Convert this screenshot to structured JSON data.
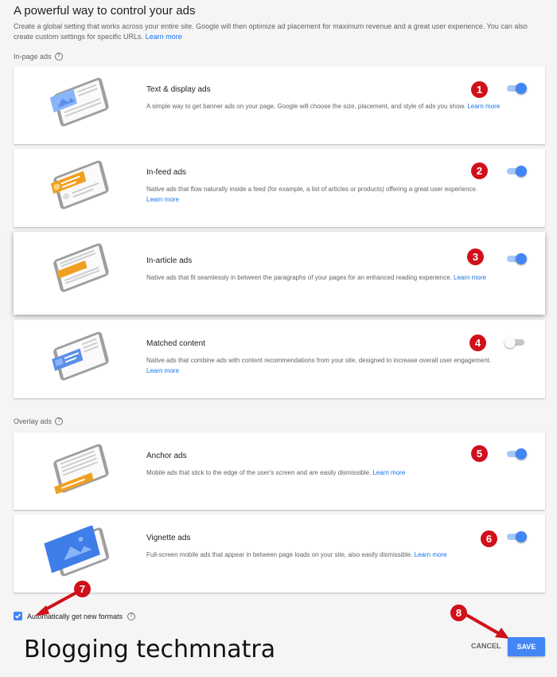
{
  "header": {
    "title": "A powerful way to control your ads",
    "intro": "Create a global setting that works across your entire site. Google will then optimize ad placement for maximum revenue and a great user experience. You can also create custom settings for specific URLs.",
    "intro_link": "Learn more"
  },
  "sections": {
    "in_page_label": "In-page ads",
    "overlay_label": "Overlay ads"
  },
  "cards": [
    {
      "title": "Text & display ads",
      "desc": "A simple way to get banner ads on your page. Google will choose the size, placement, and style of ads you show.",
      "link": "Learn more",
      "enabled": true,
      "badge": "1",
      "illustration": "text-display-illustration"
    },
    {
      "title": "In-feed ads",
      "desc": "Native ads that flow naturally inside a feed (for example, a list of articles or products) offering a great user experience.",
      "link": "Learn more",
      "enabled": true,
      "badge": "2",
      "illustration": "in-feed-illustration"
    },
    {
      "title": "In-article ads",
      "desc": "Native ads that fit seamlessly in between the paragraphs of your pages for an enhanced reading experience.",
      "link": "Learn more",
      "enabled": true,
      "badge": "3",
      "illustration": "in-article-illustration"
    },
    {
      "title": "Matched content",
      "desc": "Native ads that combine ads with content recommendations from your site, designed to increase overall user engagement.",
      "link": "Learn more",
      "enabled": false,
      "badge": "4",
      "illustration": "matched-content-illustration"
    },
    {
      "title": "Anchor ads",
      "desc": "Mobile ads that stick to the edge of the user's screen and are easily dismissible.",
      "link": "Learn more",
      "enabled": true,
      "badge": "5",
      "illustration": "anchor-illustration"
    },
    {
      "title": "Vignette ads",
      "desc": "Full-screen mobile ads that appear in between page loads on your site, also easily dismissible.",
      "link": "Learn more",
      "enabled": true,
      "badge": "6",
      "illustration": "vignette-illustration"
    }
  ],
  "footer": {
    "auto_formats_label": "Automatically get new formats",
    "auto_formats_checked": true,
    "badge7": "7",
    "badge8": "8",
    "cancel_label": "CANCEL",
    "save_label": "SAVE"
  },
  "watermark": "Blogging techmnatra",
  "colors": {
    "accent": "#4285f4",
    "badge": "#d0101a",
    "ad_orange": "#f0a020",
    "ad_blue": "#5b8fe8"
  }
}
